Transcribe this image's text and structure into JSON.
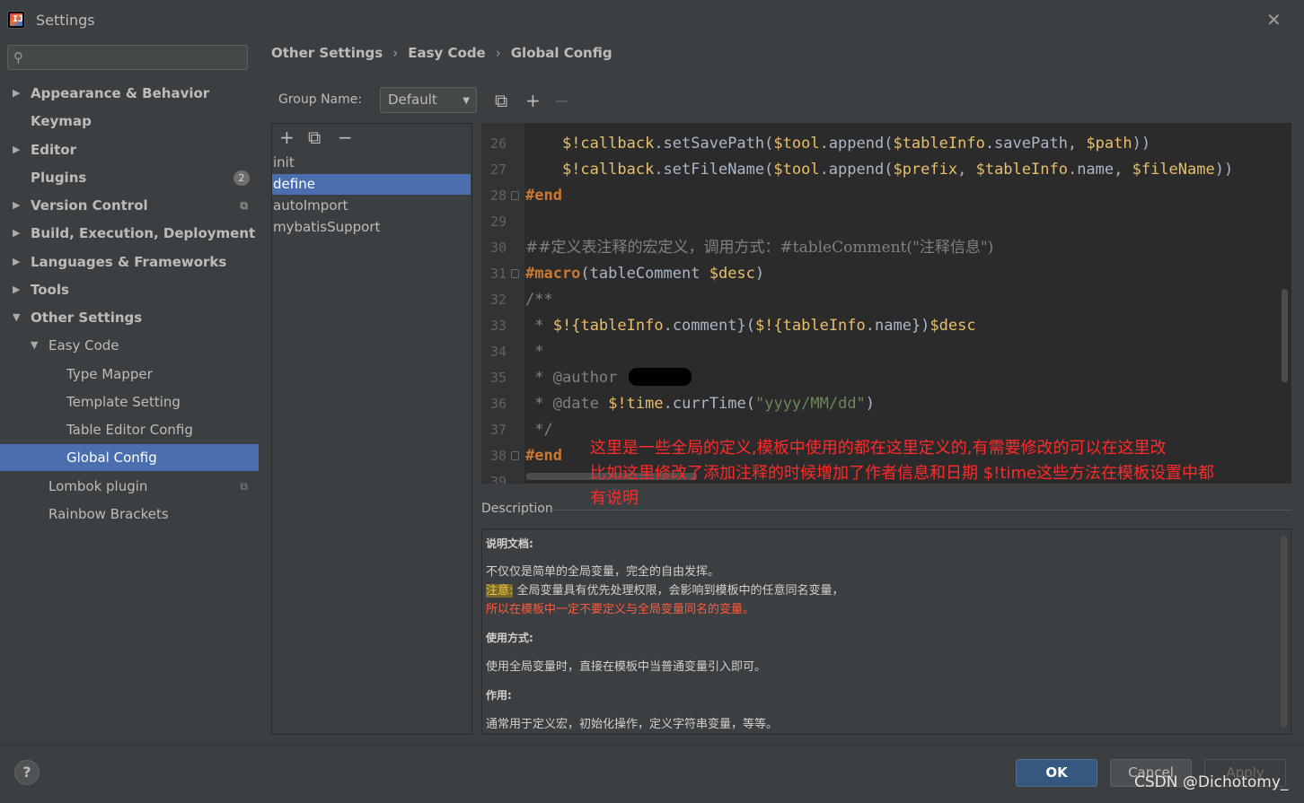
{
  "window": {
    "title": "Settings",
    "close_glyph": "✕"
  },
  "search": {
    "placeholder": "",
    "icon": "search-icon"
  },
  "sidebar": {
    "items": [
      {
        "label": "Appearance & Behavior",
        "bold": true,
        "arrow": "▶"
      },
      {
        "label": "Keymap",
        "bold": true
      },
      {
        "label": "Editor",
        "bold": true,
        "arrow": "▶"
      },
      {
        "label": "Plugins",
        "bold": true,
        "badge": "2"
      },
      {
        "label": "Version Control",
        "bold": true,
        "arrow": "▶"
      },
      {
        "label": "Build, Execution, Deployment",
        "bold": true,
        "arrow": "▶"
      },
      {
        "label": "Languages & Frameworks",
        "bold": true,
        "arrow": "▶"
      },
      {
        "label": "Tools",
        "bold": true,
        "arrow": "▶"
      },
      {
        "label": "Other Settings",
        "bold": true,
        "arrow": "▼"
      },
      {
        "label": "Easy Code",
        "arrow": "▼"
      },
      {
        "label": "Type Mapper"
      },
      {
        "label": "Template Setting"
      },
      {
        "label": "Table Editor Config"
      },
      {
        "label": "Global Config",
        "selected": true
      },
      {
        "label": "Lombok plugin"
      },
      {
        "label": "Rainbow Brackets"
      }
    ]
  },
  "breadcrumb": {
    "items": [
      "Other Settings",
      "Easy Code",
      "Global Config"
    ],
    "separator": "›"
  },
  "group": {
    "label": "Group Name:",
    "value": "Default"
  },
  "toolbar": {
    "copy_glyph": "⧉",
    "add_glyph": "+",
    "remove_glyph": "−"
  },
  "list": {
    "items": [
      "init",
      "define",
      "autoImport",
      "mybatisSupport"
    ],
    "selected": "define"
  },
  "editor": {
    "lines": [
      {
        "n": "26",
        "code": "    $!callback.setSavePath($tool.append($tableInfo.savePath, $path))"
      },
      {
        "n": "27",
        "code": "    $!callback.setFileName($tool.append($prefix, $tableInfo.name, $fileName))"
      },
      {
        "n": "28",
        "code": "#end"
      },
      {
        "n": "29",
        "code": ""
      },
      {
        "n": "30",
        "code": "##定义表注释的宏定义，调用方式：#tableComment(\"注释信息\")"
      },
      {
        "n": "31",
        "code": "#macro(tableComment $desc)"
      },
      {
        "n": "32",
        "code": "/**"
      },
      {
        "n": "33",
        "code": " * $!{tableInfo.comment}($!{tableInfo.name})$desc"
      },
      {
        "n": "34",
        "code": " *"
      },
      {
        "n": "35",
        "code": " * @author"
      },
      {
        "n": "36",
        "code": " * @date $!time.currTime(\"yyyy/MM/dd\")"
      },
      {
        "n": "37",
        "code": " */"
      },
      {
        "n": "38",
        "code": "#end"
      },
      {
        "n": "39",
        "code": ""
      }
    ]
  },
  "annotation": {
    "line1": "这里是一些全局的定义,模板中使用的都在这里定义的,有需要修改的可以在这里改",
    "line2": "比如这里修改了添加注释的时候增加了作者信息和日期 $!time这些方法在模板设置中都",
    "line3": "有说明"
  },
  "description": {
    "label": "Description",
    "doc_heading": "说明文档:",
    "doc_text": "不仅仅是简单的全局变量，完全的自由发挥。",
    "note_tag": "注意:",
    "note_text": "全局变量具有优先处理权限，会影响到模板中的任意同名变量，",
    "warn_text": "所以在模板中一定不要定义与全局变量同名的变量。",
    "usage_heading": "使用方式:",
    "usage_text": "使用全局变量时，直接在模板中当普通变量引入即可。",
    "effect_heading": "作用:",
    "effect_text": "通常用于定义宏，初始化操作，定义字符串变量，等等。"
  },
  "buttons": {
    "help": "?",
    "ok": "OK",
    "cancel": "Cancel",
    "apply": "Apply"
  },
  "watermark": "CSDN @Dichotomy_",
  "colors": {
    "selection": "#4b6eaf",
    "background": "#3c3f41",
    "editor_bg": "#2b2b2b",
    "annotation": "#ff2b2b"
  }
}
